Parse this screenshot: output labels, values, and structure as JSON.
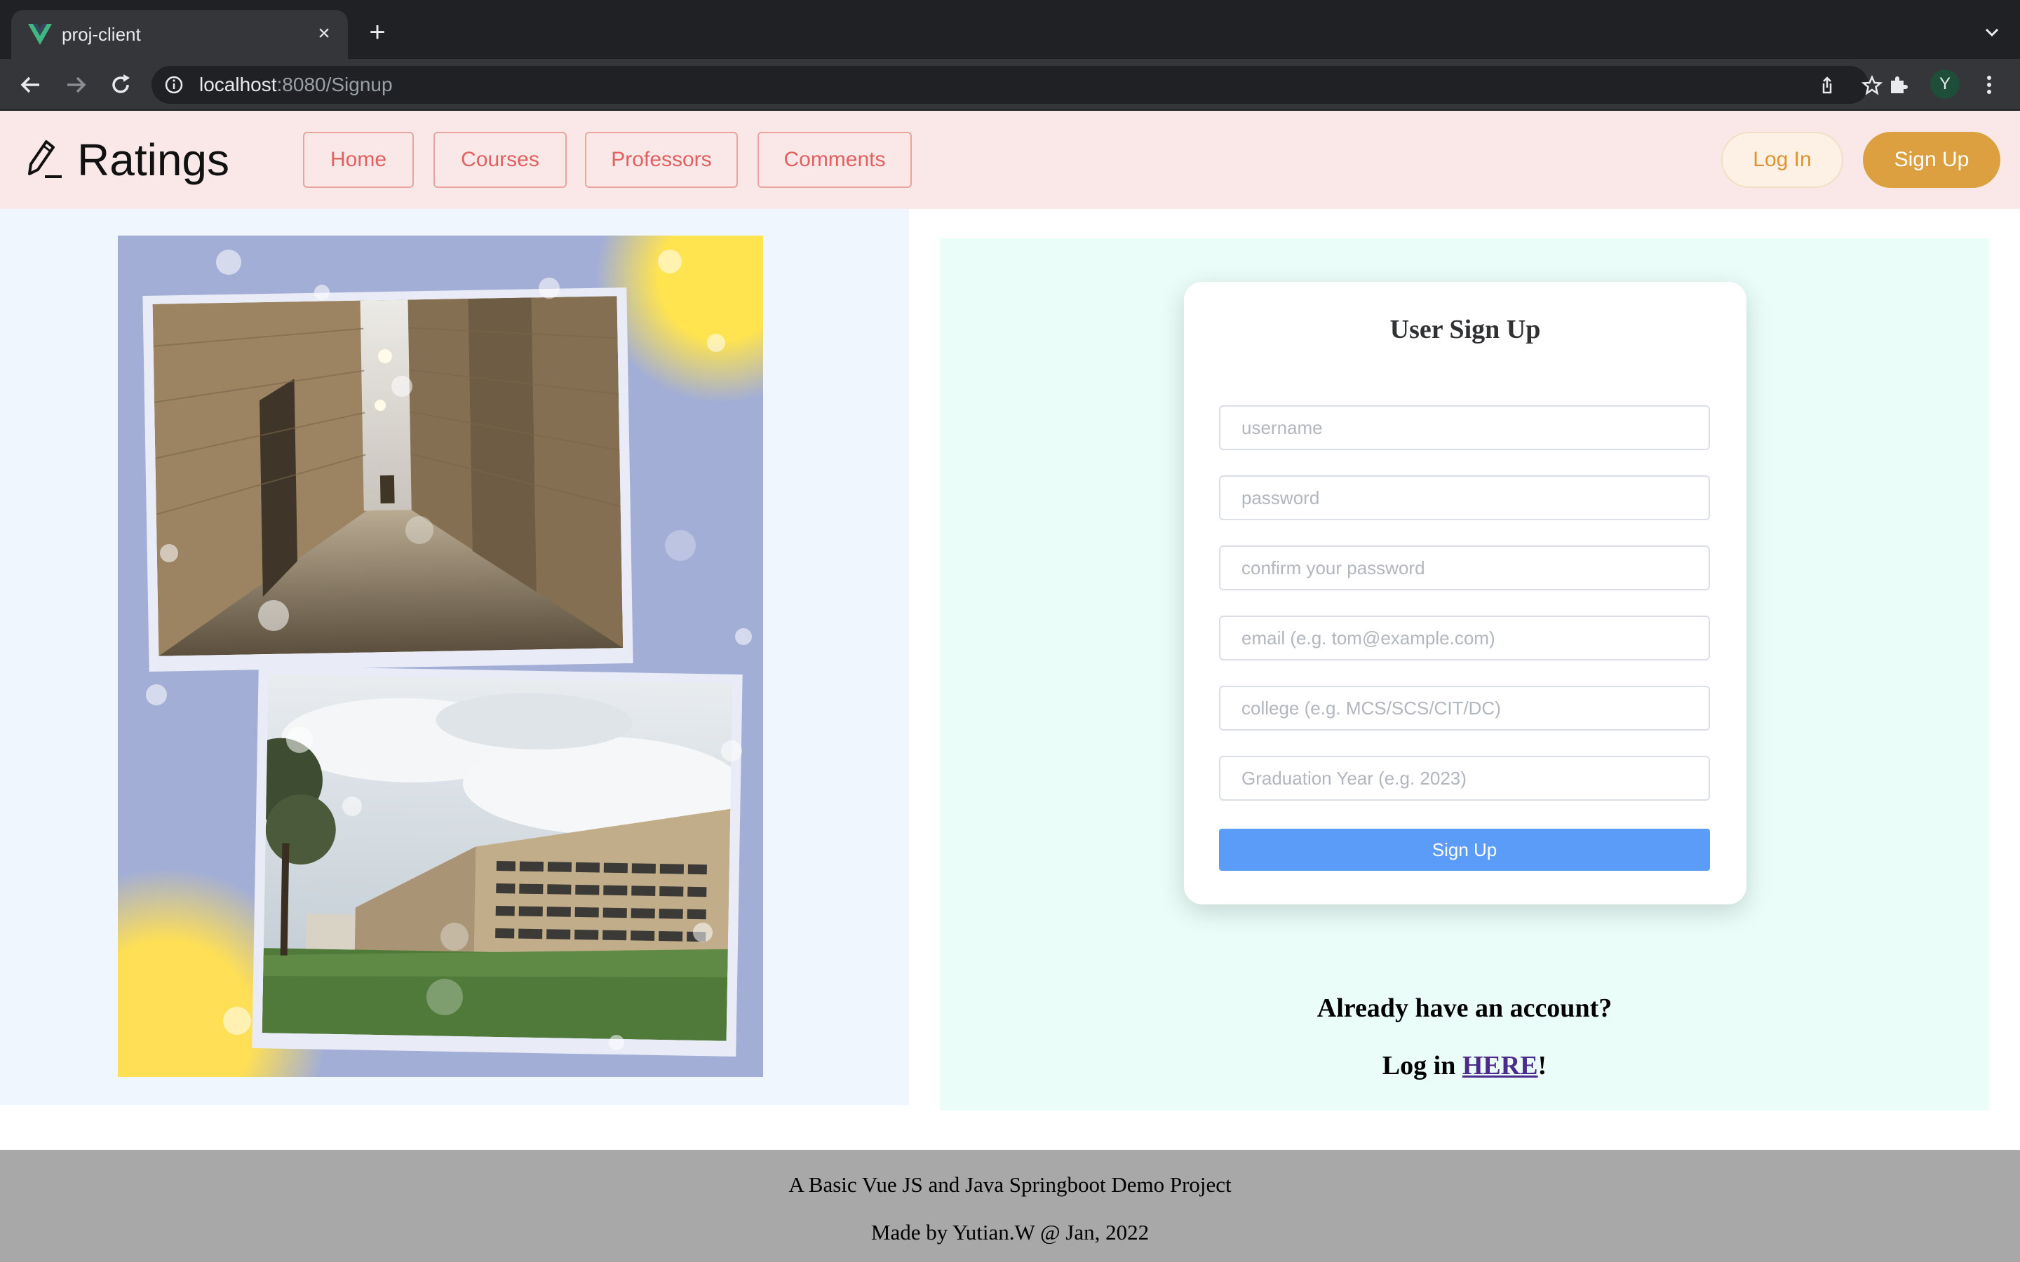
{
  "browser": {
    "tab_title": "proj-client",
    "url_host": "localhost",
    "url_rest": ":8080/Signup",
    "avatar_initial": "Y"
  },
  "header": {
    "brand": "Ratings",
    "nav": [
      "Home",
      "Courses",
      "Professors",
      "Comments"
    ],
    "login_label": "Log In",
    "signup_label": "Sign Up"
  },
  "form": {
    "title": "User Sign Up",
    "placeholders": {
      "username": "username",
      "password": "password",
      "confirm": "confirm your password",
      "email": "email (e.g. tom@example.com)",
      "college": "college (e.g. MCS/SCS/CIT/DC)",
      "grad_year": "Graduation Year (e.g. 2023)"
    },
    "submit_label": "Sign Up"
  },
  "login_prompt": {
    "question": "Already have an account?",
    "prefix": "Log in ",
    "link": "HERE",
    "suffix": "!"
  },
  "footer": {
    "line1": "A Basic Vue JS and Java Springboot Demo Project",
    "line2": "Made by Yutian.W @ Jan, 2022"
  },
  "colors": {
    "header_bg": "#f9e8e7",
    "nav_text": "#e16060",
    "signup_accent": "#dca040",
    "form_button": "#5a9cf8",
    "right_panel_bg": "#eafdf8",
    "left_panel_bg": "#f0f6fd",
    "footer_bg": "#a8a8a8"
  },
  "icons": [
    "vue-favicon-icon",
    "close-icon",
    "plus-icon",
    "chevron-down-icon",
    "back-icon",
    "forward-icon",
    "reload-icon",
    "info-icon",
    "share-icon",
    "star-icon",
    "extensions-icon",
    "more-icon",
    "pencil-icon"
  ]
}
